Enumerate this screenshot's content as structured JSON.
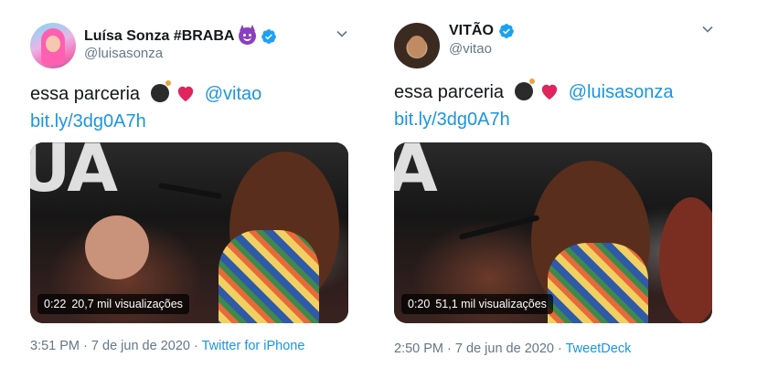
{
  "tweets": [
    {
      "display_name": "Luísa Sonza #BRABA",
      "handle": "@luisasonza",
      "text_prefix": "essa parceria",
      "mention": "@vitao",
      "link": "bit.ly/3dg0A7h",
      "video": {
        "duration": "0:22",
        "views": "20,7 mil visualizações",
        "overlay_text": "UA"
      },
      "time": "3:51 PM",
      "date": "7 de jun de 2020",
      "source": "Twitter for iPhone",
      "icons": [
        "smiling-devil-icon",
        "verified-icon",
        "chevron-down-icon",
        "bomb-icon",
        "heart-icon"
      ]
    },
    {
      "display_name": "VITÃO",
      "handle": "@vitao",
      "text_prefix": "essa parceria",
      "mention": "@luisasonza",
      "link": "bit.ly/3dg0A7h",
      "video": {
        "duration": "0:20",
        "views": "51,1 mil visualizações",
        "overlay_text": "A"
      },
      "time": "2:50 PM",
      "date": "7 de jun de 2020",
      "source": "TweetDeck",
      "icons": [
        "verified-icon",
        "chevron-down-icon",
        "bomb-icon",
        "heart-icon"
      ]
    }
  ],
  "colors": {
    "link": "#1b95e0",
    "secondary_text": "#657786",
    "primary_text": "#14171a",
    "verified": "#1da1f2",
    "heart": "#e0245e"
  }
}
